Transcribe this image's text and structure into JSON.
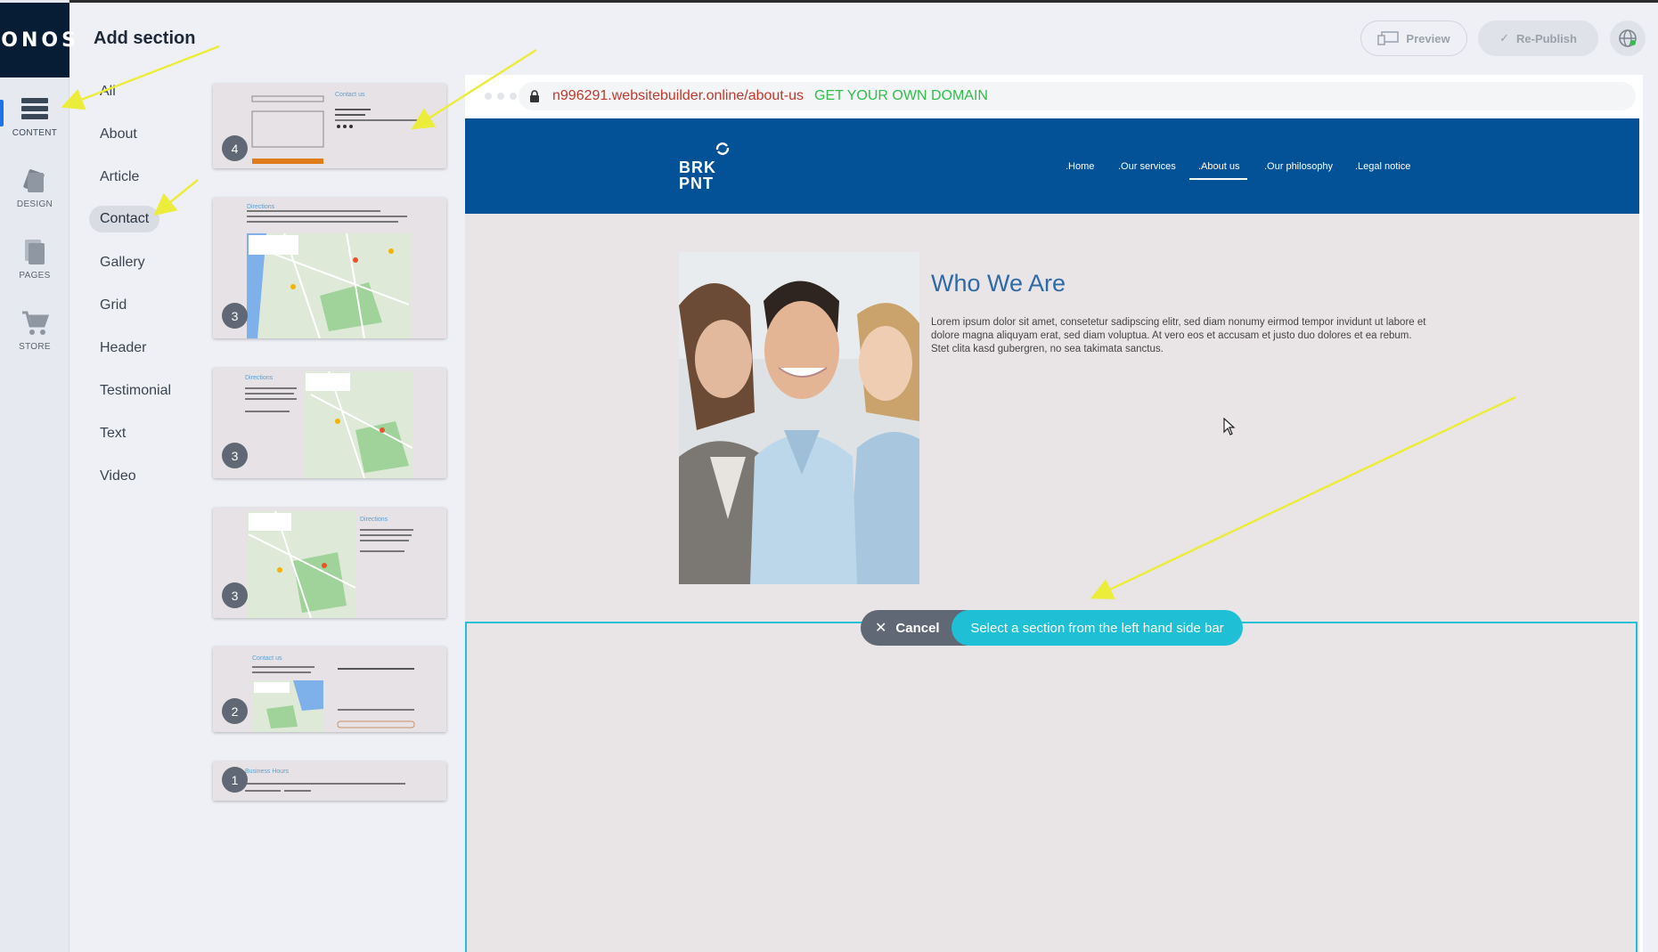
{
  "brand": {
    "logo_text": "IONOS"
  },
  "rail": {
    "items": [
      {
        "label": "CONTENT",
        "icon": "content-icon",
        "active": true
      },
      {
        "label": "DESIGN",
        "icon": "design-icon"
      },
      {
        "label": "PAGES",
        "icon": "pages-icon"
      },
      {
        "label": "STORE",
        "icon": "store-icon"
      }
    ]
  },
  "panel": {
    "title": "Add section",
    "categories": [
      "All",
      "About",
      "Article",
      "Contact",
      "Gallery",
      "Grid",
      "Header",
      "Testimonial",
      "Text",
      "Video"
    ],
    "selected_category": "Contact",
    "thumbnails": [
      {
        "badge": "4",
        "heading": "Contact us"
      },
      {
        "badge": "3",
        "heading": "Directions"
      },
      {
        "badge": "3",
        "heading": "Directions"
      },
      {
        "badge": "3",
        "heading": "Directions"
      },
      {
        "badge": "2",
        "heading": "Contact us"
      },
      {
        "badge": "1",
        "heading": "Business Hours"
      }
    ]
  },
  "toolbar": {
    "preview_label": "Preview",
    "republish_label": "Re-Publish"
  },
  "browser": {
    "url": "n996291.websitebuilder.online/about-us",
    "domain_cta": "GET YOUR OWN DOMAIN"
  },
  "site": {
    "logo_line1": "BRK",
    "logo_line2": "PNT",
    "nav": [
      ".Home",
      ".Our services",
      ".About us",
      ".Our philosophy",
      ".Legal notice"
    ],
    "active_nav": ".About us",
    "heading": "Who We Are",
    "body": "Lorem ipsum dolor sit amet, consetetur sadipscing elitr, sed diam nonumy eirmod tempor invidunt ut labore et dolore magna aliquyam erat, sed diam voluptua. At vero eos et accusam et justo duo dolores et ea rebum. Stet clita kasd gubergren, no sea takimata sanctus."
  },
  "insert_bar": {
    "cancel_label": "Cancel",
    "hint": "Select a section from the left hand side bar"
  },
  "colors": {
    "header_blue": "#035197",
    "accent_cyan": "#1fbfd6",
    "url_red": "#c0392b",
    "domain_green": "#2fbf4a",
    "logo_bg": "#071d35"
  }
}
